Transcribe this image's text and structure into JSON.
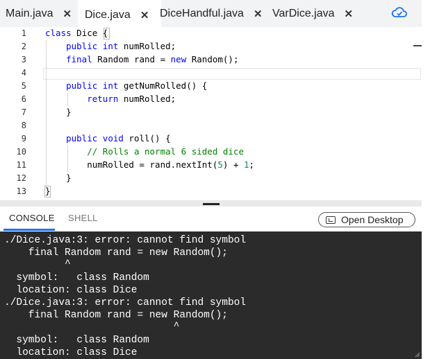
{
  "tabs": [
    {
      "label": "Main.java",
      "close": "✕"
    },
    {
      "label": "Dice.java",
      "close": "✕"
    },
    {
      "label": "DiceHandful.java",
      "close": "✕"
    },
    {
      "label": "VarDice.java",
      "close": "✕"
    }
  ],
  "icons": {
    "cloud": "cloud-sync-icon",
    "desktop": "desktop-icon"
  },
  "editor": {
    "line_numbers": [
      "1",
      "2",
      "3",
      "4",
      "5",
      "6",
      "7",
      "8",
      "9",
      "10",
      "11",
      "12",
      "13"
    ]
  },
  "console_tabs": {
    "console": "CONSOLE",
    "shell": "SHELL"
  },
  "open_desktop": "Open Desktop",
  "console_output": [
    "./Dice.java:3: error: cannot find symbol",
    "    final Random rand = new Random();",
    "          ^",
    "  symbol:   class Random",
    "  location: class Dice",
    "./Dice.java:3: error: cannot find symbol",
    "    final Random rand = new Random();",
    "                            ^",
    "  symbol:   class Random",
    "  location: class Dice"
  ],
  "colors": {
    "keyword": "#0000ff",
    "comment": "#008000",
    "number": "#098658",
    "console_bg": "#2b2b2b",
    "accent": "#1a73e8"
  }
}
